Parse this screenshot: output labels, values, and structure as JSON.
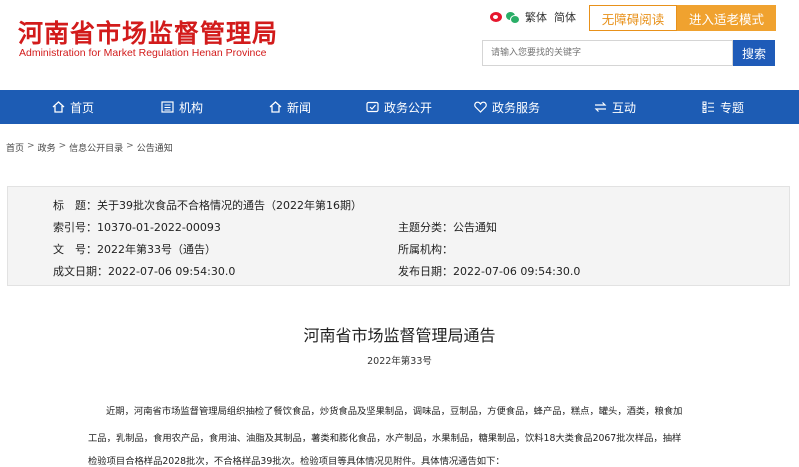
{
  "header": {
    "logo_cn": "河南省市场监督管理局",
    "logo_en": "Administration for Market Regulation Henan Province",
    "lang_traditional": "繁体",
    "lang_simplified": "简体",
    "accessibility_button": "无障碍阅读",
    "elder_mode_button": "进入适老模式",
    "search_placeholder": "请输入您要找的关键字",
    "search_button": "搜索"
  },
  "nav": {
    "items": [
      {
        "label": "首页",
        "icon": "home-icon"
      },
      {
        "label": "机构",
        "icon": "building-icon"
      },
      {
        "label": "新闻",
        "icon": "news-icon"
      },
      {
        "label": "政务公开",
        "icon": "shield-icon"
      },
      {
        "label": "政务服务",
        "icon": "heart-icon"
      },
      {
        "label": "互动",
        "icon": "exchange-icon"
      },
      {
        "label": "专题",
        "icon": "list-icon"
      }
    ]
  },
  "breadcrumb": [
    "首页",
    "政务",
    "信息公开目录",
    "公告通知"
  ],
  "breadcrumb_sep": ">",
  "info": {
    "title_label": "标　题：",
    "title_value": "关于39批次食品不合格情况的通告（2022年第16期）",
    "index_label": "索引号：",
    "index_value": "10370-01-2022-00093",
    "category_label": "主题分类：",
    "category_value": "公告通知",
    "docno_label": "文　号：",
    "docno_value": "2022年第33号（通告）",
    "org_label": "所属机构：",
    "org_value": "",
    "created_label": "成文日期：",
    "created_value": "2022-07-06 09:54:30.0",
    "published_label": "发布日期：",
    "published_value": "2022-07-06 09:54:30.0"
  },
  "article": {
    "heading": "河南省市场监督管理局通告",
    "number": "2022年第33号",
    "lines": [
      "近期，河南省市场监督管理局组织抽检了餐饮食品，炒货食品及坚果制品，调味品，豆制品，方便食品，蜂产品，糕点，罐头，酒类，粮食加",
      "工品，乳制品，食用农产品，食用油、油脂及其制品，薯类和膨化食品，水产制品，水果制品，糖果制品，饮料18大类食品2067批次样品，抽样",
      "检验项目合格样品2028批次，不合格样品39批次。检验项目等具体情况见附件。具体情况通告如下："
    ]
  }
}
